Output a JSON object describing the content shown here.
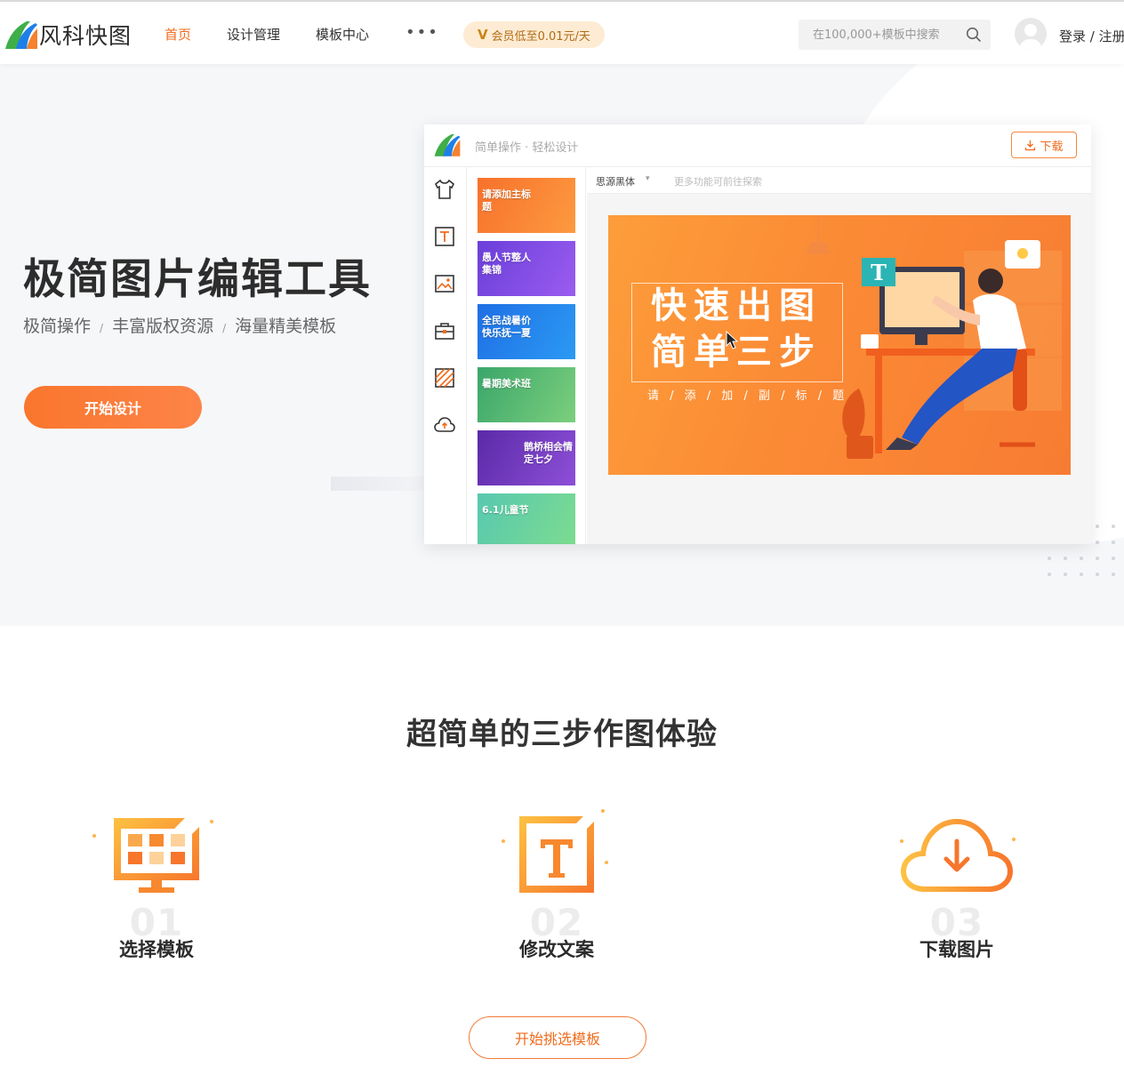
{
  "header": {
    "logo_text": "风科快图",
    "nav": [
      {
        "label": "首页",
        "active": true
      },
      {
        "label": "设计管理",
        "active": false
      },
      {
        "label": "模板中心",
        "active": false
      }
    ],
    "more_label": "•••",
    "vip_badge": "会员低至0.01元/天",
    "vip_mark": "V",
    "search_placeholder": "在100,000+模板中搜索",
    "login_label": "登录 / 注册"
  },
  "hero": {
    "title": "极简图片编辑工具",
    "subtitle_items": [
      "极简操作",
      "丰富版权资源",
      "海量精美模板"
    ],
    "subtitle_sep": "/",
    "cta_label": "开始设计"
  },
  "mock_editor": {
    "caption": "简单操作 · 轻松设计",
    "download_label": "下载",
    "font_name": "思源黑体",
    "more_features": "更多功能可前往探索",
    "thumbnails": [
      {
        "label": "请添加主标题",
        "color_from": "#f7712c",
        "color_to": "#fd9a3f"
      },
      {
        "label": "愚人节整人集锦",
        "color_from": "#6a3fd9",
        "color_to": "#9b5cf0"
      },
      {
        "label": "全民战暑价快乐抚一夏",
        "color_from": "#1f6fe5",
        "color_to": "#2b9af3"
      },
      {
        "label": "暑期美术班",
        "color_from": "#3aa66a",
        "color_to": "#7ccf7d"
      },
      {
        "label": "鹊桥相会情定七夕",
        "color_from": "#5a2aa8",
        "color_to": "#8e4fd8"
      },
      {
        "label": "6.1儿童节",
        "color_from": "#58c8b0",
        "color_to": "#7cdc8f"
      }
    ],
    "canvas": {
      "title": "快速出图 简单三步",
      "subtitle": "请 / 添 / 加 / 副 / 标 / 题"
    }
  },
  "steps": {
    "title": "超简单的三步作图体验",
    "items": [
      {
        "num": "01",
        "label": "选择模板",
        "icon": "template-grid-icon"
      },
      {
        "num": "02",
        "label": "修改文案",
        "icon": "text-edit-icon"
      },
      {
        "num": "03",
        "label": "下载图片",
        "icon": "cloud-download-icon"
      }
    ],
    "cta_label": "开始挑选模板"
  },
  "colors": {
    "accent": "#f06a1b",
    "accent_light": "#fd8448",
    "vip_bg": "#fdecd3"
  }
}
